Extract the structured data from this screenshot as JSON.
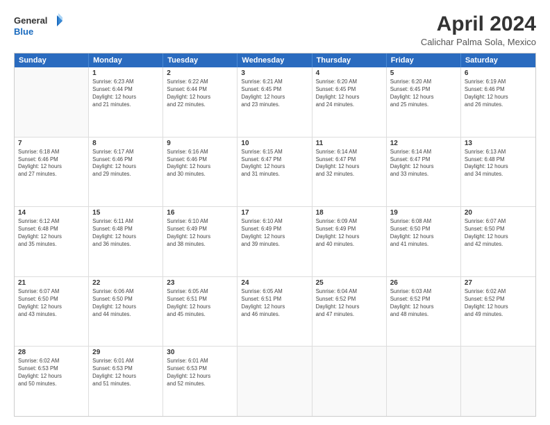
{
  "header": {
    "logo_line1": "General",
    "logo_line2": "Blue",
    "title": "April 2024",
    "subtitle": "Calichar Palma Sola, Mexico"
  },
  "calendar": {
    "days_of_week": [
      "Sunday",
      "Monday",
      "Tuesday",
      "Wednesday",
      "Thursday",
      "Friday",
      "Saturday"
    ],
    "rows": [
      [
        {
          "day": "",
          "empty": true
        },
        {
          "day": "1",
          "sunrise": "6:23 AM",
          "sunset": "6:44 PM",
          "daylight": "12 hours and 21 minutes."
        },
        {
          "day": "2",
          "sunrise": "6:22 AM",
          "sunset": "6:44 PM",
          "daylight": "12 hours and 22 minutes."
        },
        {
          "day": "3",
          "sunrise": "6:21 AM",
          "sunset": "6:45 PM",
          "daylight": "12 hours and 23 minutes."
        },
        {
          "day": "4",
          "sunrise": "6:20 AM",
          "sunset": "6:45 PM",
          "daylight": "12 hours and 24 minutes."
        },
        {
          "day": "5",
          "sunrise": "6:20 AM",
          "sunset": "6:45 PM",
          "daylight": "12 hours and 25 minutes."
        },
        {
          "day": "6",
          "sunrise": "6:19 AM",
          "sunset": "6:46 PM",
          "daylight": "12 hours and 26 minutes."
        }
      ],
      [
        {
          "day": "7",
          "sunrise": "6:18 AM",
          "sunset": "6:46 PM",
          "daylight": "12 hours and 27 minutes."
        },
        {
          "day": "8",
          "sunrise": "6:17 AM",
          "sunset": "6:46 PM",
          "daylight": "12 hours and 29 minutes."
        },
        {
          "day": "9",
          "sunrise": "6:16 AM",
          "sunset": "6:46 PM",
          "daylight": "12 hours and 30 minutes."
        },
        {
          "day": "10",
          "sunrise": "6:15 AM",
          "sunset": "6:47 PM",
          "daylight": "12 hours and 31 minutes."
        },
        {
          "day": "11",
          "sunrise": "6:14 AM",
          "sunset": "6:47 PM",
          "daylight": "12 hours and 32 minutes."
        },
        {
          "day": "12",
          "sunrise": "6:14 AM",
          "sunset": "6:47 PM",
          "daylight": "12 hours and 33 minutes."
        },
        {
          "day": "13",
          "sunrise": "6:13 AM",
          "sunset": "6:48 PM",
          "daylight": "12 hours and 34 minutes."
        }
      ],
      [
        {
          "day": "14",
          "sunrise": "6:12 AM",
          "sunset": "6:48 PM",
          "daylight": "12 hours and 35 minutes."
        },
        {
          "day": "15",
          "sunrise": "6:11 AM",
          "sunset": "6:48 PM",
          "daylight": "12 hours and 36 minutes."
        },
        {
          "day": "16",
          "sunrise": "6:10 AM",
          "sunset": "6:49 PM",
          "daylight": "12 hours and 38 minutes."
        },
        {
          "day": "17",
          "sunrise": "6:10 AM",
          "sunset": "6:49 PM",
          "daylight": "12 hours and 39 minutes."
        },
        {
          "day": "18",
          "sunrise": "6:09 AM",
          "sunset": "6:49 PM",
          "daylight": "12 hours and 40 minutes."
        },
        {
          "day": "19",
          "sunrise": "6:08 AM",
          "sunset": "6:50 PM",
          "daylight": "12 hours and 41 minutes."
        },
        {
          "day": "20",
          "sunrise": "6:07 AM",
          "sunset": "6:50 PM",
          "daylight": "12 hours and 42 minutes."
        }
      ],
      [
        {
          "day": "21",
          "sunrise": "6:07 AM",
          "sunset": "6:50 PM",
          "daylight": "12 hours and 43 minutes."
        },
        {
          "day": "22",
          "sunrise": "6:06 AM",
          "sunset": "6:50 PM",
          "daylight": "12 hours and 44 minutes."
        },
        {
          "day": "23",
          "sunrise": "6:05 AM",
          "sunset": "6:51 PM",
          "daylight": "12 hours and 45 minutes."
        },
        {
          "day": "24",
          "sunrise": "6:05 AM",
          "sunset": "6:51 PM",
          "daylight": "12 hours and 46 minutes."
        },
        {
          "day": "25",
          "sunrise": "6:04 AM",
          "sunset": "6:52 PM",
          "daylight": "12 hours and 47 minutes."
        },
        {
          "day": "26",
          "sunrise": "6:03 AM",
          "sunset": "6:52 PM",
          "daylight": "12 hours and 48 minutes."
        },
        {
          "day": "27",
          "sunrise": "6:02 AM",
          "sunset": "6:52 PM",
          "daylight": "12 hours and 49 minutes."
        }
      ],
      [
        {
          "day": "28",
          "sunrise": "6:02 AM",
          "sunset": "6:53 PM",
          "daylight": "12 hours and 50 minutes."
        },
        {
          "day": "29",
          "sunrise": "6:01 AM",
          "sunset": "6:53 PM",
          "daylight": "12 hours and 51 minutes."
        },
        {
          "day": "30",
          "sunrise": "6:01 AM",
          "sunset": "6:53 PM",
          "daylight": "12 hours and 52 minutes."
        },
        {
          "day": "",
          "empty": true
        },
        {
          "day": "",
          "empty": true
        },
        {
          "day": "",
          "empty": true
        },
        {
          "day": "",
          "empty": true
        }
      ]
    ]
  }
}
